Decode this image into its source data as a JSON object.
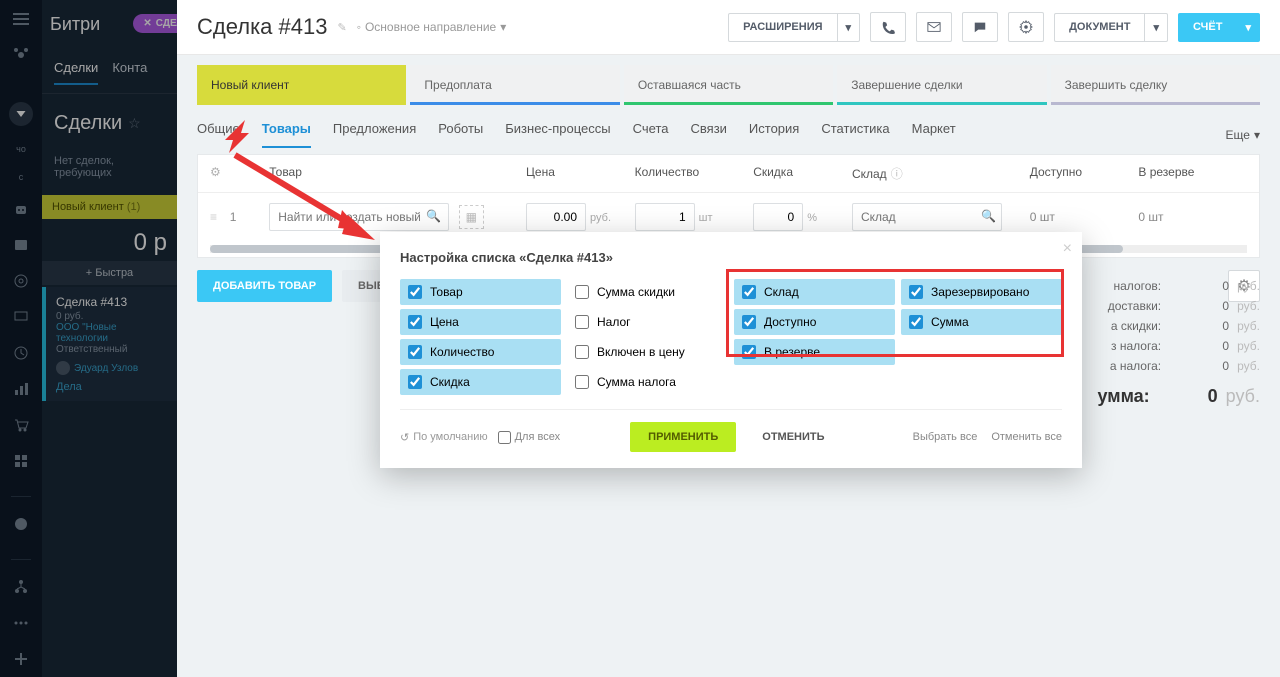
{
  "app": {
    "name": "Битри",
    "badge": "СДЕЛКА",
    "cho": "чо"
  },
  "dark_tabs": {
    "deals": "Сделки",
    "contacts": "Конта"
  },
  "section": {
    "title": "Сделки",
    "empty": "Нет сделок, требующих"
  },
  "yellow": {
    "label": "Новый клиент",
    "count": "(1)"
  },
  "big_zero": "0 р",
  "quick_add": "+ Быстра",
  "card": {
    "title": "Сделка #413",
    "price": "0 руб.",
    "company": "ООО \"Новые технологии",
    "resp": "Ответственный",
    "user": "Эдуард Узлов",
    "link": "Дела"
  },
  "header": {
    "title": "Сделка #413",
    "direction": "Основное направление",
    "ext": "РАСШИРЕНИЯ",
    "doc": "ДОКУМЕНТ",
    "account": "СЧЁТ"
  },
  "stages": [
    "Новый клиент",
    "Предоплата",
    "Оставшаяся часть",
    "Завершение сделки",
    "Завершить сделку"
  ],
  "tabs": {
    "general": "Общие",
    "products": "Товары",
    "offers": "Предложения",
    "robots": "Роботы",
    "bp": "Бизнес-процессы",
    "inv": "Счета",
    "links": "Связи",
    "history": "История",
    "stats": "Статистика",
    "market": "Маркет",
    "more": "Еще"
  },
  "thead": {
    "product": "Товар",
    "price": "Цена",
    "qty": "Количество",
    "discount": "Скидка",
    "store": "Склад",
    "avail": "Доступно",
    "reserve": "В резерве"
  },
  "row": {
    "num": "1",
    "prod_ph": "Найти или создать новый товар",
    "price": "0.00",
    "price_unit": "руб.",
    "qty": "1",
    "qty_unit": "шт",
    "disc": "0",
    "disc_unit": "%",
    "store_ph": "Склад",
    "avail": "0 шт",
    "res": "0 шт"
  },
  "actions": {
    "add": "ДОБАВИТЬ ТОВАР",
    "pick": "ВЫБРАТЬ ТОВ"
  },
  "totals": {
    "r1": {
      "l": "налогов:",
      "v": "0",
      "u": "руб."
    },
    "r2": {
      "l": "доставки:",
      "v": "0",
      "u": "руб."
    },
    "r3": {
      "l": "а скидки:",
      "v": "0",
      "u": "руб."
    },
    "r4": {
      "l": "з налога:",
      "v": "0",
      "u": "руб."
    },
    "r5": {
      "l": "а налога:",
      "v": "0",
      "u": "руб."
    },
    "sum": {
      "l": "умма:",
      "v": "0",
      "u": "руб."
    }
  },
  "modal": {
    "title": "Настройка списка «Сделка #413»",
    "col1": [
      {
        "l": "Товар",
        "c": true
      },
      {
        "l": "Цена",
        "c": true
      },
      {
        "l": "Количество",
        "c": true
      },
      {
        "l": "Скидка",
        "c": true
      }
    ],
    "col2": [
      {
        "l": "Сумма скидки",
        "c": false
      },
      {
        "l": "Налог",
        "c": false
      },
      {
        "l": "Включен в цену",
        "c": false
      },
      {
        "l": "Сумма налога",
        "c": false
      }
    ],
    "col3": [
      {
        "l": "Склад",
        "c": true
      },
      {
        "l": "Доступно",
        "c": true
      },
      {
        "l": "В резерве",
        "c": true
      }
    ],
    "col4": [
      {
        "l": "Зарезервировано",
        "c": true
      },
      {
        "l": "Сумма",
        "c": true
      }
    ],
    "revert": "По умолчанию",
    "forall": "Для всех",
    "apply": "ПРИМЕНИТЬ",
    "cancel": "ОТМЕНИТЬ",
    "sel_all": "Выбрать все",
    "cancel_all": "Отменить все"
  }
}
